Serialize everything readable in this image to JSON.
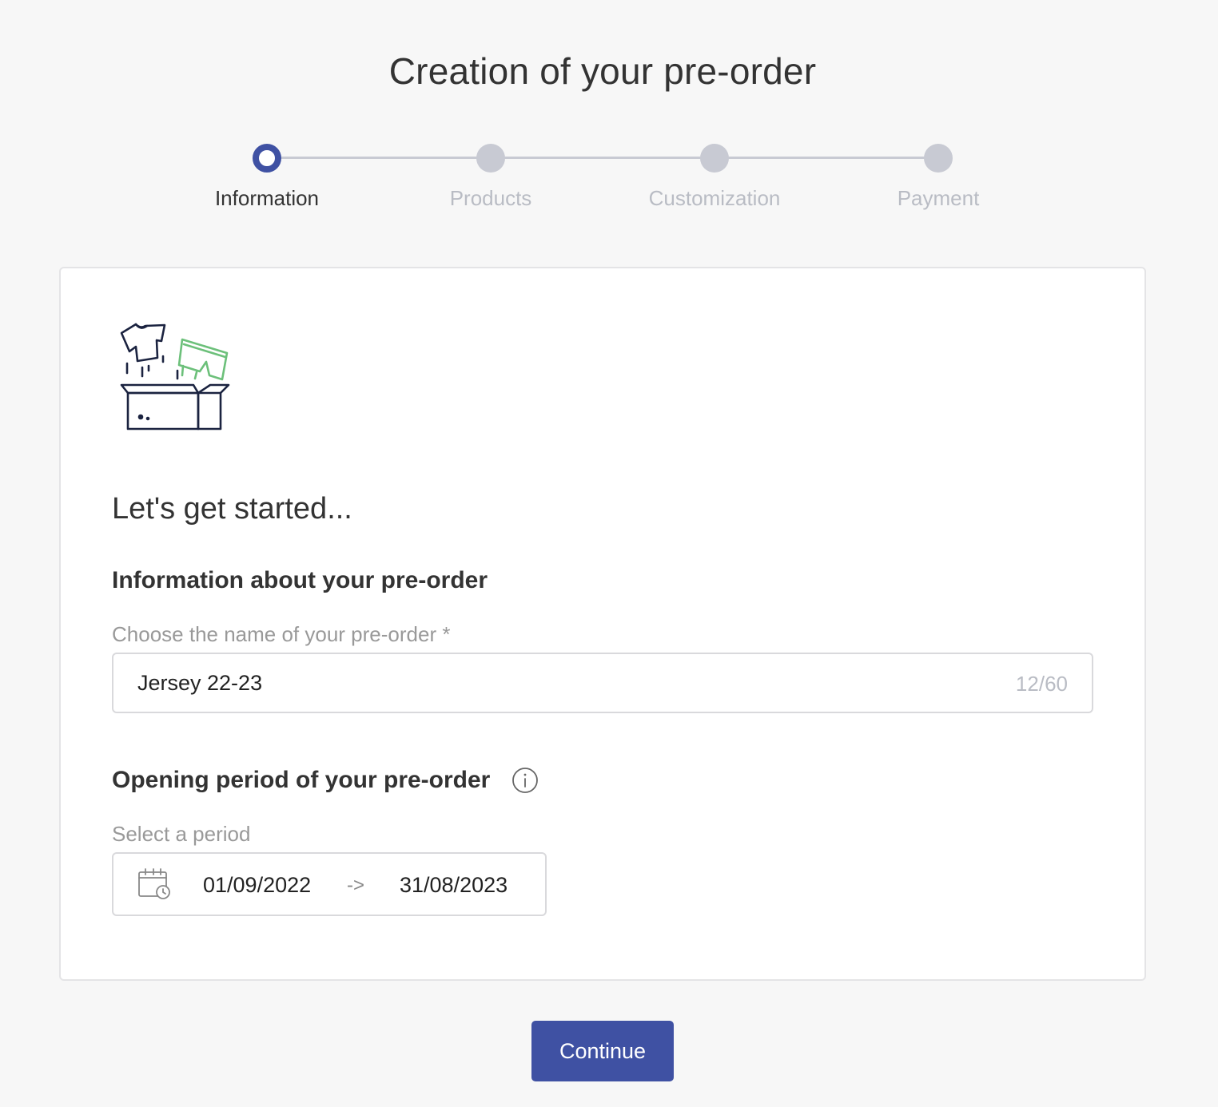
{
  "page": {
    "title": "Creation of your pre-order"
  },
  "stepper": {
    "steps": [
      {
        "label": "Information",
        "state": "active"
      },
      {
        "label": "Products",
        "state": "inactive"
      },
      {
        "label": "Customization",
        "state": "inactive"
      },
      {
        "label": "Payment",
        "state": "inactive"
      }
    ]
  },
  "card": {
    "illustration_icon": "box-with-clothes-icon",
    "intro_heading": "Let's get started...",
    "info_section": {
      "heading": "Information about your pre-order",
      "name_label": "Choose the name of your pre-order *",
      "name_value": "Jersey 22-23",
      "char_count": "12/60"
    },
    "period_section": {
      "heading": "Opening period of your pre-order",
      "info_icon": "info-icon",
      "label": "Select a period",
      "calendar_icon": "calendar-clock-icon",
      "start_date": "01/09/2022",
      "arrow": "->",
      "end_date": "31/08/2023"
    }
  },
  "actions": {
    "continue_label": "Continue"
  },
  "colors": {
    "accent": "#3f51a3",
    "inactive_step": "#c8cad3",
    "background": "#f7f7f7",
    "illustration_accent": "#6cc07a",
    "illustration_line": "#1b2340"
  }
}
